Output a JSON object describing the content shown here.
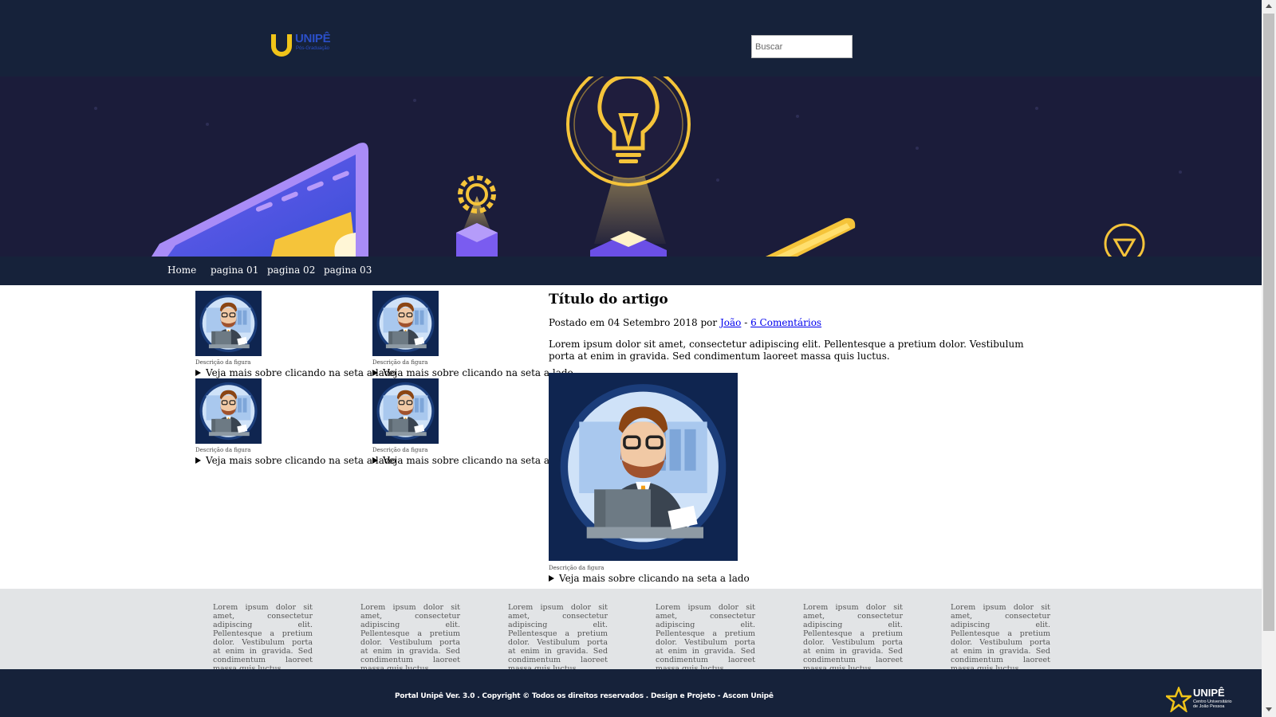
{
  "header": {
    "logo_text": "UNIPÊ",
    "logo_subtitle": "Pós-Graduação",
    "search_placeholder": "Buscar"
  },
  "nav": {
    "items": [
      "Home",
      "pagina 01",
      "pagina 02",
      "pagina 03"
    ]
  },
  "thumbnails": [
    {
      "caption": "Descrição da figura",
      "details": "Veja mais sobre clicando na seta a lado"
    },
    {
      "caption": "Descrição da figura",
      "details": "Veja mais sobre clicando na seta a lado"
    },
    {
      "caption": "Descrição da figura",
      "details": "Veja mais sobre clicando na seta a lado"
    },
    {
      "caption": "Descrição da figura",
      "details": "Veja mais sobre clicando na seta a lado"
    }
  ],
  "article": {
    "title": "Título do artigo",
    "meta_prefix": "Postado em 04 Setembro 2018 por",
    "author": "João",
    "separator": "-",
    "comments": "6 Comentários",
    "body": "Lorem ipsum dolor sit amet, consectetur adipiscing elit. Pellentesque a pretium dolor. Vestibulum porta at enim in gravida. Sed condimentum laoreet massa quis luctus.",
    "figure_caption": "Descrição da figura",
    "figure_details": "Veja mais sobre clicando na seta a lado"
  },
  "footer": {
    "columns": [
      "Lorem ipsum dolor sit amet, consectetur adipiscing elit. Pellentesque a pretium dolor. Vestibulum porta at enim in gravida. Sed condimentum laoreet massa quis luctus.",
      "Lorem ipsum dolor sit amet, consectetur adipiscing elit. Pellentesque a pretium dolor. Vestibulum porta at enim in gravida. Sed condimentum laoreet massa quis luctus.",
      "Lorem ipsum dolor sit amet, consectetur adipiscing elit. Pellentesque a pretium dolor. Vestibulum porta at enim in gravida. Sed condimentum laoreet massa quis luctus.",
      "Lorem ipsum dolor sit amet, consectetur adipiscing elit. Pellentesque a pretium dolor. Vestibulum porta at enim in gravida. Sed condimentum laoreet massa quis luctus.",
      "Lorem ipsum dolor sit amet, consectetur adipiscing elit. Pellentesque a pretium dolor. Vestibulum porta at enim in gravida. Sed condimentum laoreet massa quis luctus.",
      "Lorem ipsum dolor sit amet, consectetur adipiscing elit. Pellentesque a pretium dolor. Vestibulum porta at enim in gravida. Sed condimentum laoreet massa quis luctus."
    ],
    "copyright": "Portal Unipê Ver. 3.0 . Copyright © Todos os direitos reservados . Design e Projeto - Ascom Unipê",
    "logo_text": "UNIPÊ",
    "logo_subtitle_1": "Centro Universitário",
    "logo_subtitle_2": "de João Pessoa"
  },
  "colors": {
    "header_bg": "#16223a",
    "banner_bg": "#1b1c3a",
    "footer_top_bg": "#e2e4e6",
    "logo_yellow": "#f0c419",
    "logo_blue": "#2b4fc7",
    "link": "#0000ee"
  }
}
